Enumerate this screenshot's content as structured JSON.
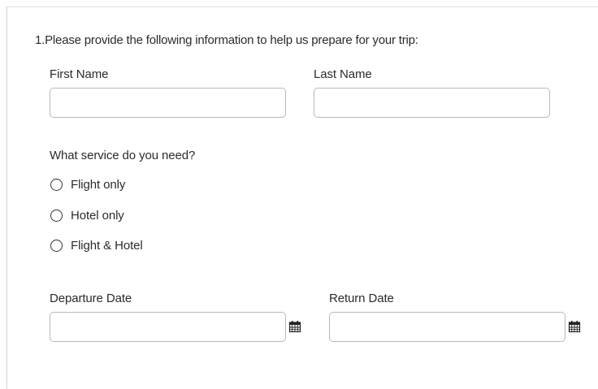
{
  "question": {
    "number": "1.",
    "text": "Please provide the following information to help us prepare for your trip:"
  },
  "fields": {
    "first_name": {
      "label": "First Name",
      "value": "",
      "placeholder": ""
    },
    "last_name": {
      "label": "Last Name",
      "value": "",
      "placeholder": ""
    }
  },
  "service": {
    "label": "What service do you need?",
    "options": [
      {
        "label": "Flight only",
        "selected": false
      },
      {
        "label": "Hotel only",
        "selected": false
      },
      {
        "label": "Flight & Hotel",
        "selected": false
      }
    ]
  },
  "dates": {
    "departure": {
      "label": "Departure Date",
      "value": "",
      "icon": "calendar-icon"
    },
    "return": {
      "label": "Return Date",
      "value": "",
      "icon": "calendar-icon"
    }
  },
  "colors": {
    "input_border": "#b9b9b9",
    "text": "#2b2b2b",
    "radio_border": "#333333"
  }
}
